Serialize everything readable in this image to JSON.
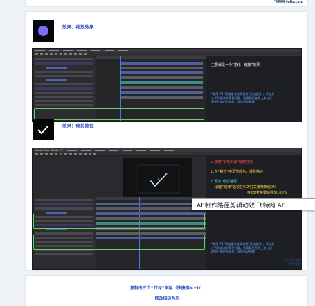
{
  "brand_top": "飞特网·feitr.com",
  "brand_bottom_line1": "feitr.com",
  "brand_bottom_line2": "飞特教程网",
  "section1": {
    "title": "效果：缩放效果",
    "thumb_icon": "circle-icon",
    "note_main": "主要就是一个“变化—缩放”效果",
    "note_detail": "*使用“F4”添加缓动效果调整“运动曲线”，添加关\n注式导缓动效果更好看。注意最后合到上来让式\n避免开始的时候后，添加运动模糊"
  },
  "section2": {
    "title": "效果：修剪路径",
    "thumb_icon": "checkmark-icon",
    "note_1": "a.使用“钢笔工具”绘制打勾",
    "note_2": "b.在“描边”中调节颜色，线段描点",
    "note_3": "c.添加“修剪路径”",
    "note_4": "调整“结束”选项在0.2f打关键帧数值0%",
    "note_5": "在20f打关键帧数值100%",
    "note_detail": "*使用“F4”添加缓动效果调整“运动曲线”，添加关\n注式导缓动效果更好看。注意最后合到上来让式\n避免开始的时候后，添加运动模糊",
    "menu_title": "Adobe After Effects CC"
  },
  "tooltip": "AE制作路径剪辑动效 飞特网 AE",
  "bottom": {
    "line1": "复制出三个“打勾”图层（快捷键⌘+D）",
    "line2": "修改描边色彩"
  },
  "colors": {
    "accent_blue": "#2d4fc4",
    "circle_purple": "#7b6cf6",
    "outline_green": "#5fd66a",
    "note_red": "#ff5050",
    "note_yellow": "#ffd33a",
    "note_cyan": "#3ee0e6"
  }
}
